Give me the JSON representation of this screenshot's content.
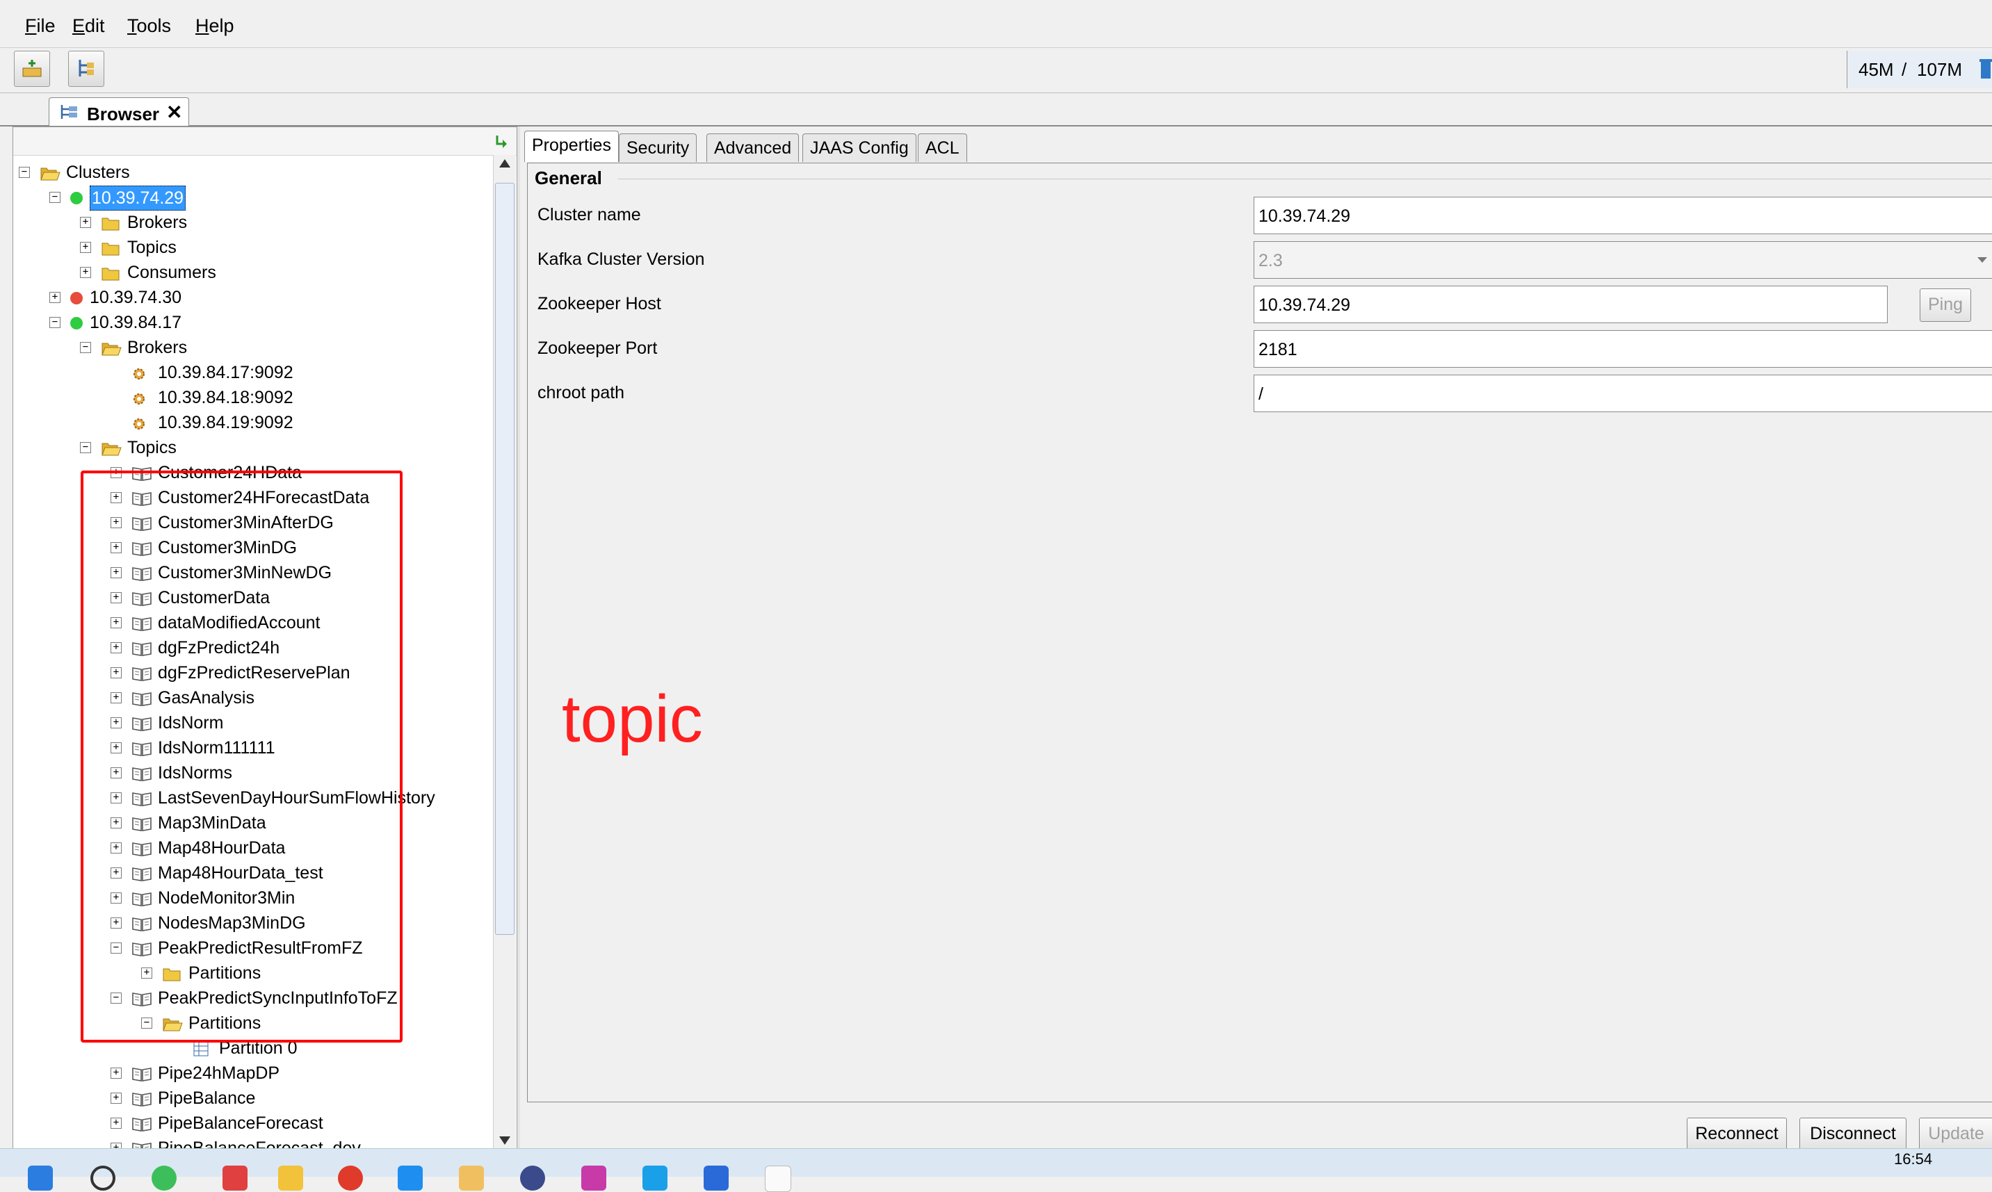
{
  "menu": [
    {
      "pre": "",
      "key": "F",
      "rest": "ile"
    },
    {
      "pre": "",
      "key": "E",
      "rest": "dit"
    },
    {
      "pre": "",
      "key": "T",
      "rest": "ools"
    },
    {
      "pre": "",
      "key": "H",
      "rest": "elp"
    }
  ],
  "memory": {
    "used": "45M",
    "sep": "/",
    "total": "107M"
  },
  "browser_tab": {
    "label": "Browser",
    "close": "✕"
  },
  "tree": {
    "root": "Clusters",
    "cluster1": {
      "name": "10.39.74.29",
      "status_color": "#2ecc40",
      "children": [
        "Brokers",
        "Topics",
        "Consumers"
      ]
    },
    "cluster2": {
      "name": "10.39.74.30",
      "status_color": "#e74c3c"
    },
    "cluster3": {
      "name": "10.39.84.17",
      "status_color": "#2ecc40",
      "brokers_label": "Brokers",
      "brokers": [
        "10.39.84.17:9092",
        "10.39.84.18:9092",
        "10.39.84.19:9092"
      ],
      "topics_label": "Topics",
      "topics": [
        "Customer24HData",
        "Customer24HForecastData",
        "Customer3MinAfterDG",
        "Customer3MinDG",
        "Customer3MinNewDG",
        "CustomerData",
        "dataModifiedAccount",
        "dgFzPredict24h",
        "dgFzPredictReservePlan",
        "GasAnalysis",
        "IdsNorm",
        "IdsNorm111111",
        "IdsNorms",
        "LastSevenDayHourSumFlowHistory",
        "Map3MinData",
        "Map48HourData",
        "Map48HourData_test",
        "NodeMonitor3Min",
        "NodesMap3MinDG",
        "PeakPredictResultFromFZ"
      ],
      "partitions_label": "Partitions",
      "topic_expanded": "PeakPredictSyncInputInfoToFZ",
      "partition0": "Partition 0",
      "topics_after": [
        "Pipe24hMapDP",
        "PipeBalance",
        "PipeBalanceForecast",
        "PipeBalanceForecast_dev"
      ]
    }
  },
  "right_tabs": [
    "Properties",
    "Security",
    "Advanced",
    "JAAS Config",
    "ACL"
  ],
  "general": {
    "title": "General",
    "cluster_name_label": "Cluster name",
    "cluster_name": "10.39.74.29",
    "kafka_version_label": "Kafka Cluster Version",
    "kafka_version": "2.3",
    "zk_host_label": "Zookeeper Host",
    "zk_host": "10.39.74.29",
    "ping_label": "Ping",
    "zk_port_label": "Zookeeper Port",
    "zk_port": "2181",
    "chroot_label": "chroot path",
    "chroot": "/"
  },
  "actions": {
    "reconnect": "Reconnect",
    "disconnect": "Disconnect",
    "update": "Update"
  },
  "annotation": "topic",
  "clock": "16:54"
}
